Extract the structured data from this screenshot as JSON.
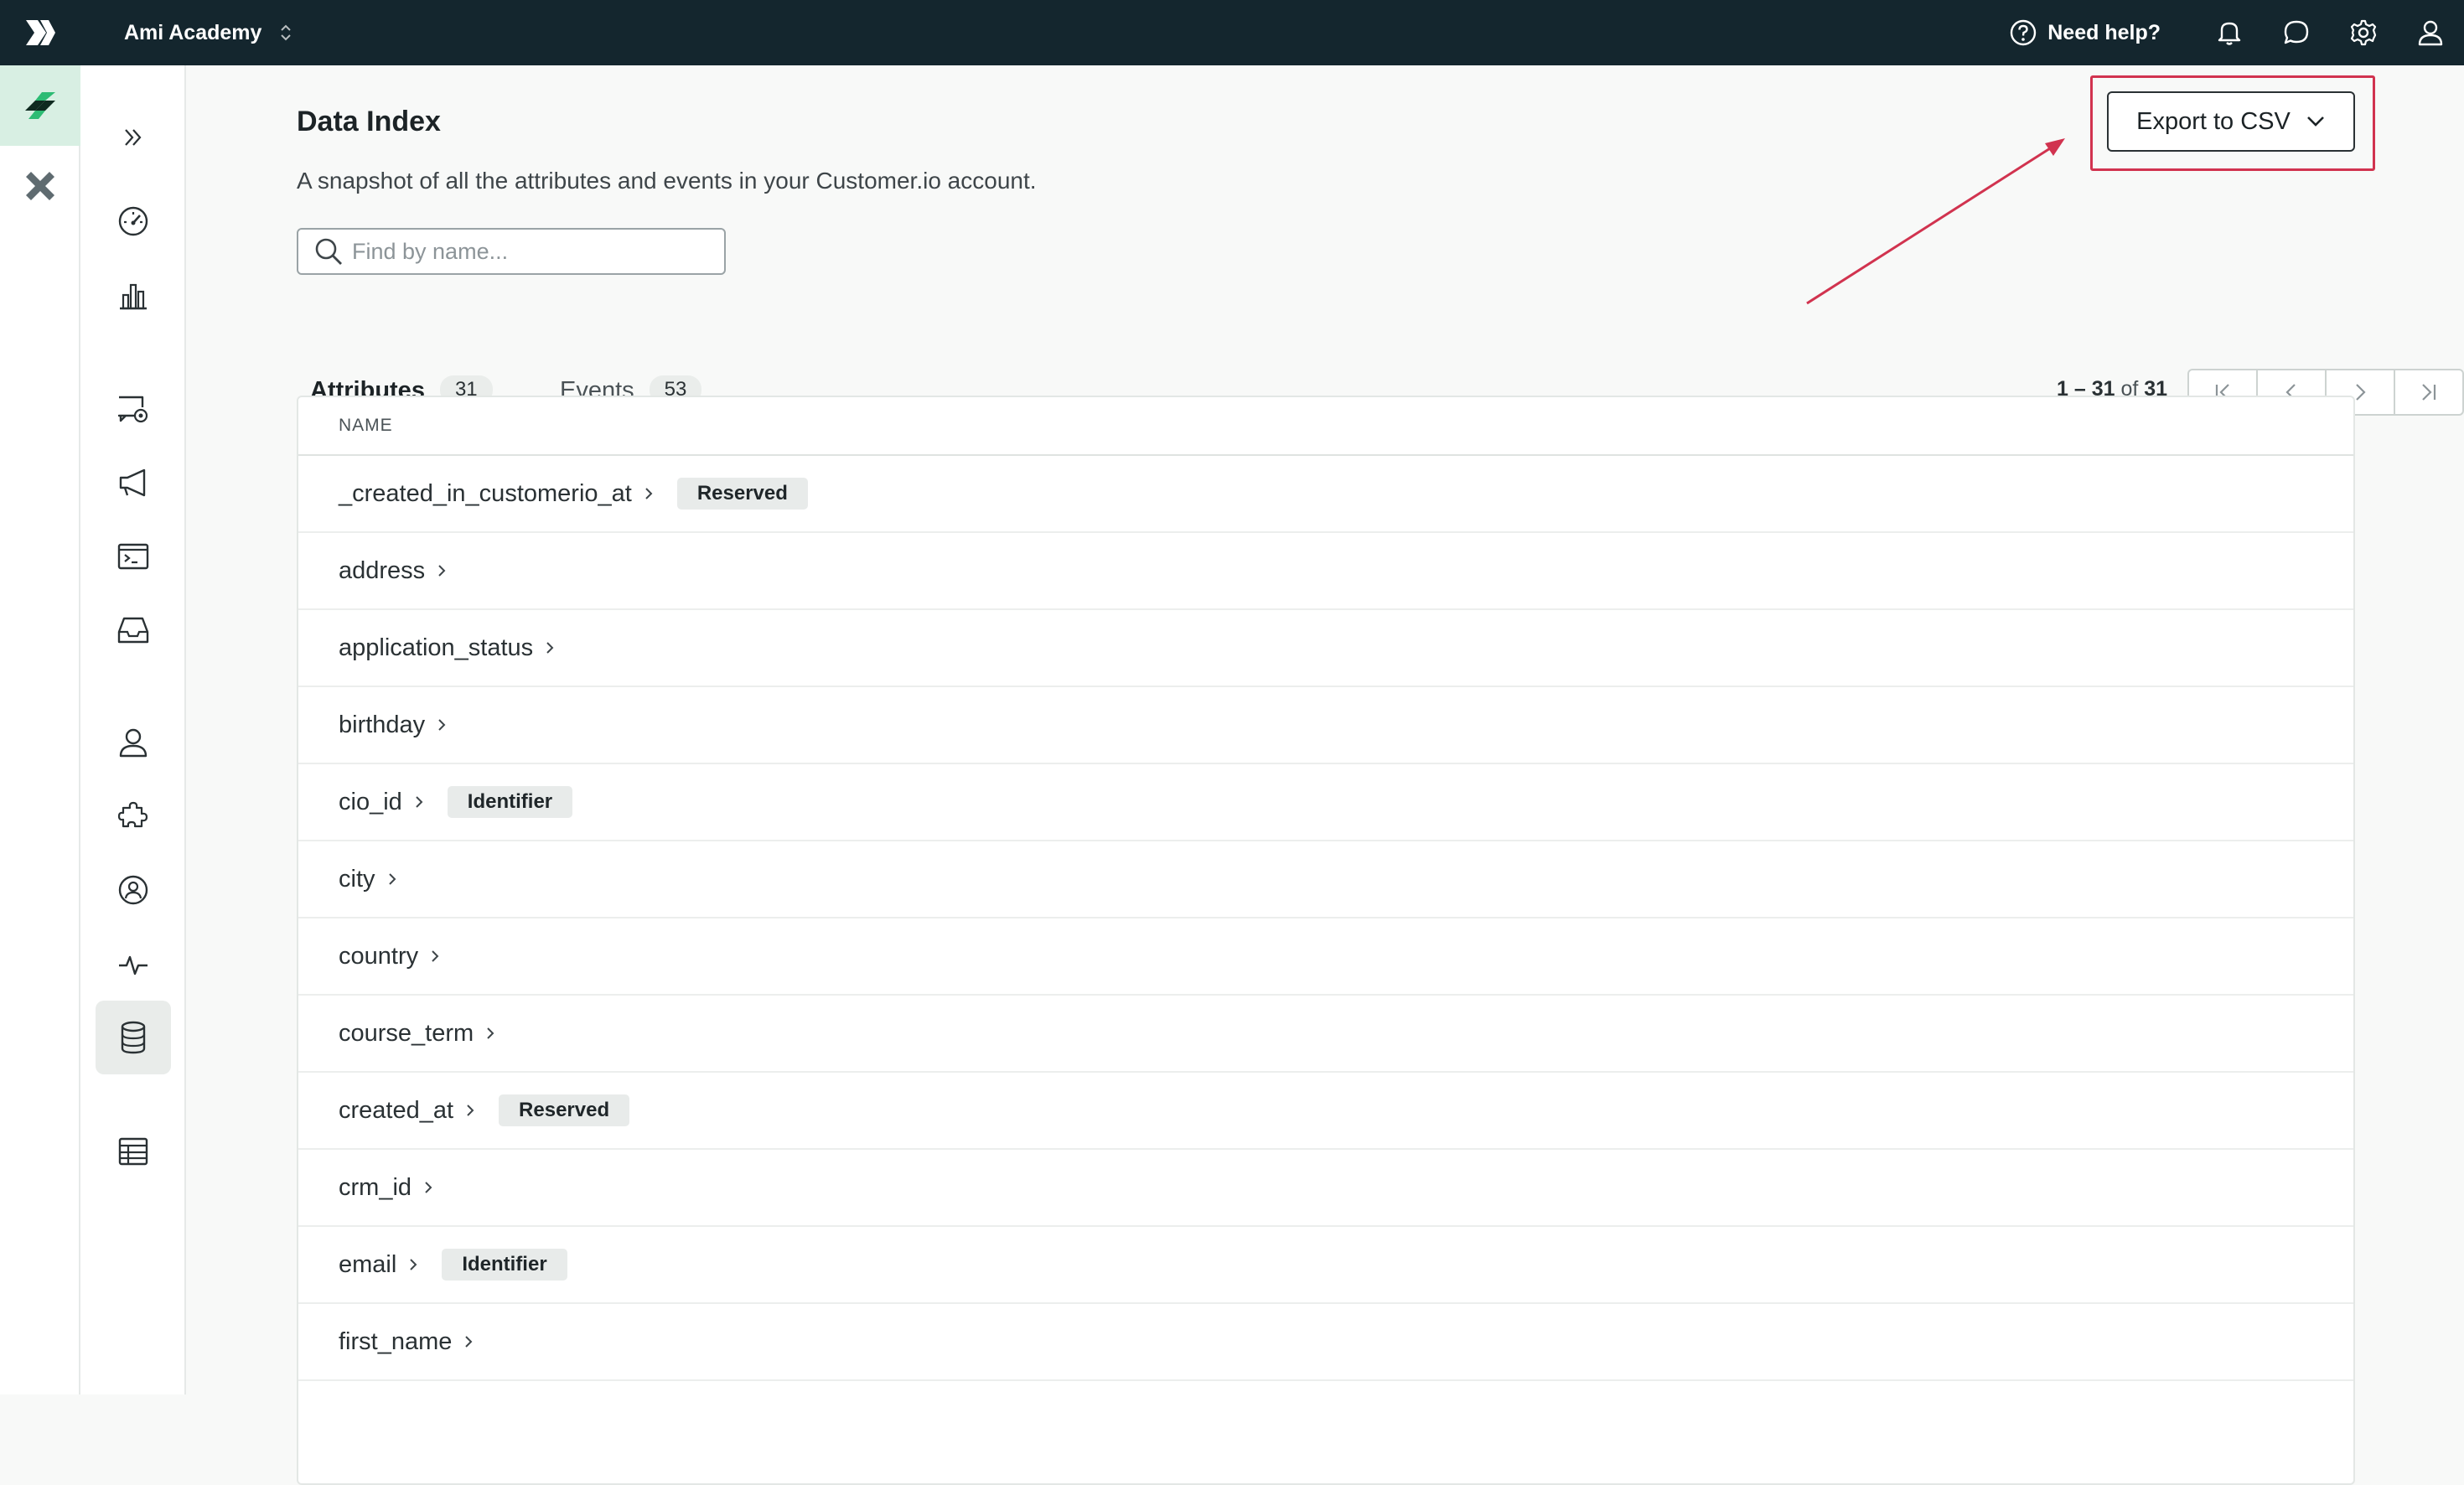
{
  "topbar": {
    "workspace": "Ami Academy",
    "help_label": "Need help?"
  },
  "page": {
    "title": "Data Index",
    "subtitle": "A snapshot of all the attributes and events in your Customer.io account.",
    "search_placeholder": "Find by name...",
    "export_label": "Export to CSV"
  },
  "tabs": [
    {
      "label": "Attributes",
      "count": "31"
    },
    {
      "label": "Events",
      "count": "53"
    }
  ],
  "pager": {
    "range": "1 – 31",
    "of": "of",
    "total": "31"
  },
  "table": {
    "header": "NAME",
    "rows": [
      {
        "name": "_created_in_customerio_at",
        "badge": "Reserved"
      },
      {
        "name": "address",
        "badge": ""
      },
      {
        "name": "application_status",
        "badge": ""
      },
      {
        "name": "birthday",
        "badge": ""
      },
      {
        "name": "cio_id",
        "badge": "Identifier"
      },
      {
        "name": "city",
        "badge": ""
      },
      {
        "name": "country",
        "badge": ""
      },
      {
        "name": "course_term",
        "badge": ""
      },
      {
        "name": "created_at",
        "badge": "Reserved"
      },
      {
        "name": "crm_id",
        "badge": ""
      },
      {
        "name": "email",
        "badge": "Identifier"
      },
      {
        "name": "first_name",
        "badge": ""
      }
    ]
  },
  "colors": {
    "topbar": "#14262e",
    "accent": "#2f6ad9",
    "highlight": "#d1334f"
  }
}
